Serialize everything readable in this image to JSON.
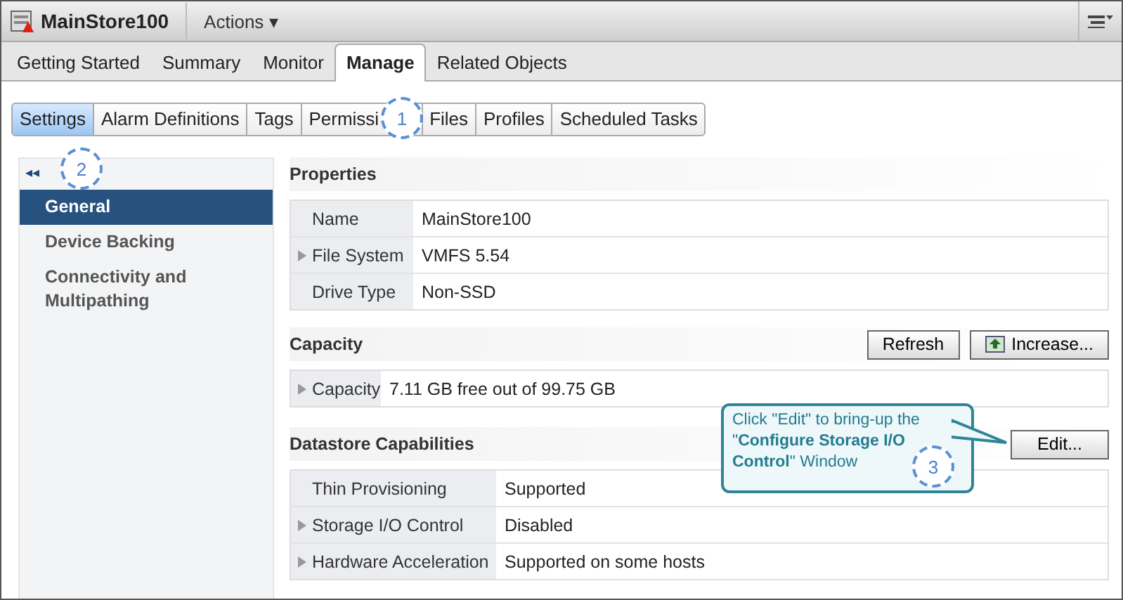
{
  "header": {
    "title": "MainStore100",
    "actions": "Actions ▾"
  },
  "tabs": [
    {
      "label": "Getting Started",
      "selected": false
    },
    {
      "label": "Summary",
      "selected": false
    },
    {
      "label": "Monitor",
      "selected": false
    },
    {
      "label": "Manage",
      "selected": true
    },
    {
      "label": "Related Objects",
      "selected": false
    }
  ],
  "subtabs": [
    {
      "label": "Settings",
      "selected": true
    },
    {
      "label": "Alarm Definitions",
      "selected": false
    },
    {
      "label": "Tags",
      "selected": false
    },
    {
      "label": "Permissi",
      "selected": false
    },
    {
      "label": "Files",
      "selected": false
    },
    {
      "label": "Profiles",
      "selected": false
    },
    {
      "label": "Scheduled Tasks",
      "selected": false
    }
  ],
  "sidebar": {
    "collapse": "◂◂",
    "items": [
      {
        "label": "General",
        "selected": true
      },
      {
        "label": "Device Backing",
        "selected": false
      },
      {
        "label": "Connectivity and Multipathing",
        "selected": false
      }
    ]
  },
  "properties": {
    "title": "Properties",
    "rows": [
      {
        "label": "Name",
        "value": "MainStore100",
        "expandable": false
      },
      {
        "label": "File System",
        "value": "VMFS 5.54",
        "expandable": true
      },
      {
        "label": "Drive Type",
        "value": "Non-SSD",
        "expandable": false
      }
    ]
  },
  "capacity": {
    "title": "Capacity",
    "buttons": [
      {
        "label": "Refresh",
        "kind": "plain"
      },
      {
        "label": "Increase...",
        "kind": "icon"
      }
    ],
    "rows": [
      {
        "label": "Capacity",
        "value": "7.11 GB free out of 99.75 GB",
        "expandable": true
      }
    ]
  },
  "capabilities": {
    "title": "Datastore Capabilities",
    "button": "Edit...",
    "rows": [
      {
        "label": "Thin Provisioning",
        "value": "Supported",
        "expandable": false
      },
      {
        "label": "Storage I/O Control",
        "value": "Disabled",
        "expandable": true
      },
      {
        "label": "Hardware Acceleration",
        "value": "Supported on some hosts",
        "expandable": true
      }
    ]
  },
  "callout": {
    "text": "Click \"Edit\" to bring-up the \"**Configure Storage I/O Control**\" Window"
  },
  "steps": [
    "1",
    "2",
    "3"
  ]
}
